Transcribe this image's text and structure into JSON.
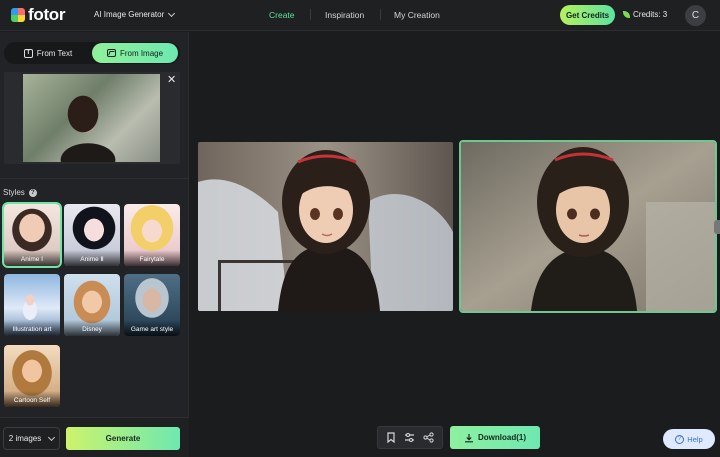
{
  "app": {
    "logo_text": "fotor"
  },
  "header": {
    "tool_menu_label": "AI Image Generator",
    "nav": [
      {
        "label": "Create",
        "active": true
      },
      {
        "label": "Inspiration",
        "active": false
      },
      {
        "label": "My Creation",
        "active": false
      }
    ],
    "get_credits_label": "Get Credits",
    "credits_text": "Credits: 3",
    "avatar_initial": "C"
  },
  "sidebar": {
    "mode_tabs": [
      {
        "label": "From Text",
        "icon": "text-icon",
        "selected": false
      },
      {
        "label": "From Image",
        "icon": "image-icon",
        "selected": true
      }
    ],
    "close_symbol": "✕",
    "styles_label": "Styles",
    "help_symbol": "?",
    "styles": [
      {
        "label": "Anime Ⅰ",
        "selected": true
      },
      {
        "label": "Anime Ⅱ",
        "selected": false
      },
      {
        "label": "Fairytale",
        "selected": false
      },
      {
        "label": "Illustration art",
        "selected": false
      },
      {
        "label": "Disney",
        "selected": false
      },
      {
        "label": "Game art style",
        "selected": false
      },
      {
        "label": "Cartoon Self",
        "selected": false
      }
    ],
    "image_count_value": "2 images",
    "generate_label": "Generate"
  },
  "main": {
    "toolbar_icons": [
      "bookmark-icon",
      "adjust-icon",
      "share-icon"
    ],
    "download_label": "Download(1)",
    "help_label": "Help"
  },
  "colors": {
    "accent_green": "#6fe4a5",
    "background": "#1b1c1e",
    "panel": "#222326"
  }
}
